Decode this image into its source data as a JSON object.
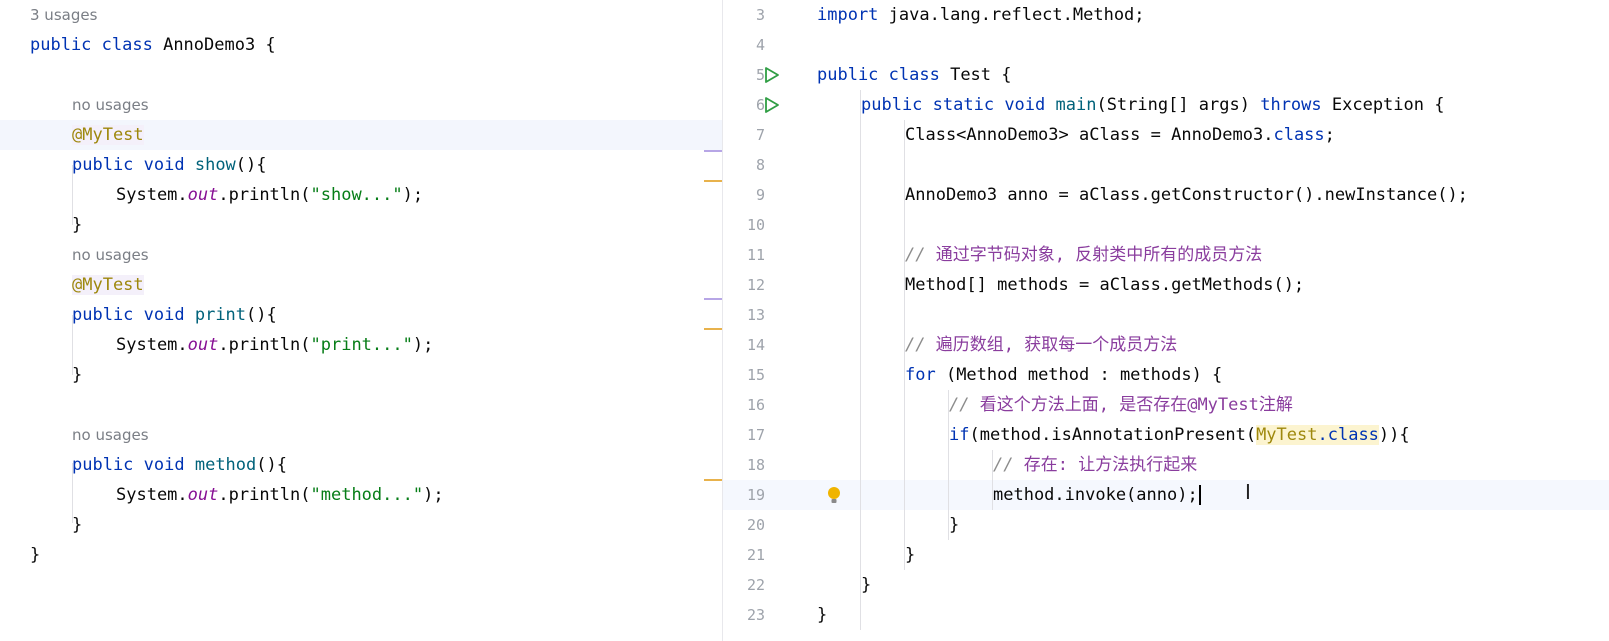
{
  "left_editor": {
    "class_usages": "3 usages",
    "lines": [
      [
        {
          "t": "public ",
          "c": "kw"
        },
        {
          "t": "class ",
          "c": "kw"
        },
        {
          "t": "AnnoDemo3 {",
          "c": ""
        }
      ],
      [
        {
          "t": "@MyTest",
          "c": "ann"
        }
      ],
      [
        {
          "t": "public ",
          "c": "kw"
        },
        {
          "t": "void ",
          "c": "kw"
        },
        {
          "t": "show",
          "c": "fn"
        },
        {
          "t": "(){",
          "c": ""
        }
      ],
      [
        {
          "t": "System.",
          "c": ""
        },
        {
          "t": "out",
          "c": "field"
        },
        {
          "t": ".println(",
          "c": ""
        },
        {
          "t": "\"show...\"",
          "c": "str"
        },
        {
          "t": ");",
          "c": ""
        }
      ],
      [
        {
          "t": "}",
          "c": ""
        }
      ],
      [
        {
          "t": "@MyTest",
          "c": "ann"
        }
      ],
      [
        {
          "t": "public ",
          "c": "kw"
        },
        {
          "t": "void ",
          "c": "kw"
        },
        {
          "t": "print",
          "c": "fn"
        },
        {
          "t": "(){",
          "c": ""
        }
      ],
      [
        {
          "t": "System.",
          "c": ""
        },
        {
          "t": "out",
          "c": "field"
        },
        {
          "t": ".println(",
          "c": ""
        },
        {
          "t": "\"print...\"",
          "c": "str"
        },
        {
          "t": ");",
          "c": ""
        }
      ],
      [
        {
          "t": "}",
          "c": ""
        }
      ],
      [
        {
          "t": "public ",
          "c": "kw"
        },
        {
          "t": "void ",
          "c": "kw"
        },
        {
          "t": "method",
          "c": "fn"
        },
        {
          "t": "(){",
          "c": ""
        }
      ],
      [
        {
          "t": "System.",
          "c": ""
        },
        {
          "t": "out",
          "c": "field"
        },
        {
          "t": ".println(",
          "c": ""
        },
        {
          "t": "\"method...\"",
          "c": "str"
        },
        {
          "t": ");",
          "c": ""
        }
      ],
      [
        {
          "t": "}",
          "c": ""
        }
      ],
      [
        {
          "t": "}",
          "c": ""
        }
      ]
    ],
    "inlays": [
      "no usages",
      "no usages",
      "no usages"
    ]
  },
  "right_editor": {
    "line_numbers": [
      "3",
      "4",
      "5",
      "6",
      "7",
      "8",
      "9",
      "10",
      "11",
      "12",
      "13",
      "14",
      "15",
      "16",
      "17",
      "18",
      "19",
      "20",
      "21",
      "22",
      "23"
    ],
    "lines": [
      [
        {
          "t": "import ",
          "c": "kw"
        },
        {
          "t": "java.lang.reflect.Method;",
          "c": ""
        }
      ],
      [],
      [
        {
          "t": "public ",
          "c": "kw"
        },
        {
          "t": "class ",
          "c": "kw"
        },
        {
          "t": "Test {",
          "c": ""
        }
      ],
      [
        {
          "t": "public ",
          "c": "kw"
        },
        {
          "t": "static ",
          "c": "kw"
        },
        {
          "t": "void ",
          "c": "kw"
        },
        {
          "t": "main",
          "c": "fn"
        },
        {
          "t": "(String[] args) ",
          "c": ""
        },
        {
          "t": "throws ",
          "c": "kw"
        },
        {
          "t": "Exception {",
          "c": ""
        }
      ],
      [
        {
          "t": "Class<AnnoDemo3> aClass = AnnoDemo3.",
          "c": ""
        },
        {
          "t": "class",
          "c": "kw"
        },
        {
          "t": ";",
          "c": ""
        }
      ],
      [],
      [
        {
          "t": "AnnoDemo3 anno = aClass.getConstructor().newInstance();",
          "c": ""
        }
      ],
      [],
      [
        {
          "t": "// ",
          "c": "cm"
        },
        {
          "t": "通过字节码对象, 反射类中所有的成员方法",
          "c": "cmcn"
        }
      ],
      [
        {
          "t": "Method[] methods = aClass.getMethods();",
          "c": ""
        }
      ],
      [],
      [
        {
          "t": "// ",
          "c": "cm"
        },
        {
          "t": "遍历数组, 获取每一个成员方法",
          "c": "cmcn"
        }
      ],
      [
        {
          "t": "for ",
          "c": "kw"
        },
        {
          "t": "(Method method : methods) {",
          "c": ""
        }
      ],
      [
        {
          "t": "// ",
          "c": "cm"
        },
        {
          "t": "看这个方法上面, 是否存在",
          "c": "cmcn"
        },
        {
          "t": "@MyTest",
          "c": "cmcn"
        },
        {
          "t": "注解",
          "c": "cmcn"
        }
      ],
      [
        {
          "t": "if",
          "c": "kw"
        },
        {
          "t": "(method.isAnnotationPresent(",
          "c": ""
        },
        {
          "t": "MyTest",
          "c": "annhl"
        },
        {
          "t": ".",
          "c": "kwhl"
        },
        {
          "t": "class",
          "c": "kwhl"
        },
        {
          "t": ")){",
          "c": ""
        }
      ],
      [
        {
          "t": "// ",
          "c": "cm"
        },
        {
          "t": "存在: 让方法执行起来",
          "c": "cmcn"
        }
      ],
      [
        {
          "t": "method.invoke(anno);",
          "c": ""
        }
      ],
      [
        {
          "t": "}",
          "c": ""
        }
      ],
      [
        {
          "t": "}",
          "c": ""
        }
      ],
      [
        {
          "t": "}",
          "c": ""
        }
      ],
      [
        {
          "t": "}",
          "c": ""
        }
      ]
    ]
  },
  "colors": {
    "keyword": "#0033b3",
    "string": "#067d17",
    "annotation": "#9e880d",
    "static_field": "#871094",
    "method_decl": "#00627a",
    "comment": "#8c8c8c",
    "run_icon": "#2f9e44",
    "bulb_icon": "#f0b400",
    "error_stripe_purple": "#b7a6e6",
    "error_stripe_yellow": "#e8b24c"
  },
  "icons": [
    "run-gutter-icon",
    "intention-bulb-icon",
    "text-cursor-ibeam"
  ]
}
